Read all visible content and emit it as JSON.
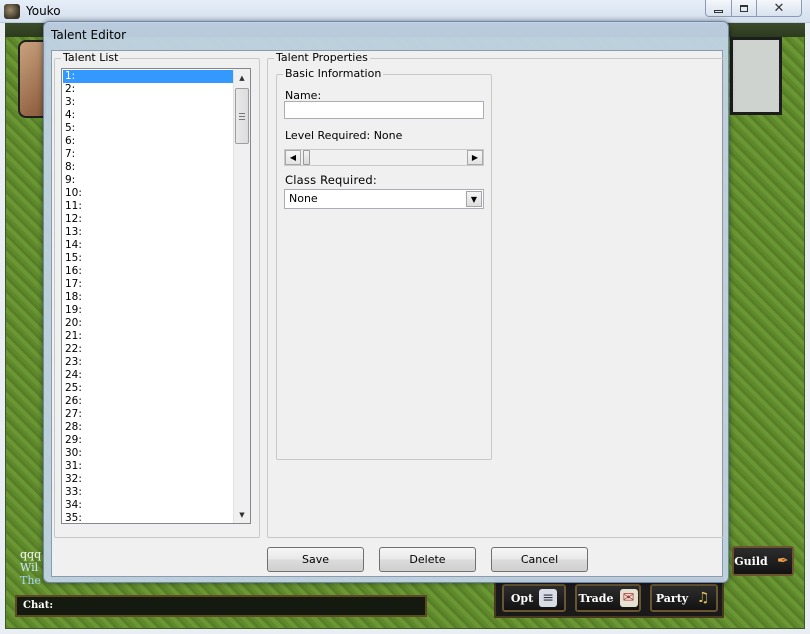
{
  "host": {
    "title": "Youko",
    "close_glyph": "✕"
  },
  "game": {
    "chat_lines": [
      "qqq",
      "Wil",
      "The"
    ],
    "chat_label": "Chat:",
    "buttons": {
      "guild": "Guild",
      "opt": "Opt",
      "trade": "Trade",
      "party": "Party"
    },
    "icons": {
      "guild": "feather-icon",
      "opt": "document-icon",
      "trade": "envelope-icon",
      "party": "harp-icon"
    }
  },
  "dialog": {
    "title": "Talent Editor",
    "talent_list": {
      "label": "Talent List",
      "items": [
        "1:",
        "2:",
        "3:",
        "4:",
        "5:",
        "6:",
        "7:",
        "8:",
        "9:",
        "10:",
        "11:",
        "12:",
        "13:",
        "14:",
        "15:",
        "16:",
        "17:",
        "18:",
        "19:",
        "20:",
        "21:",
        "22:",
        "23:",
        "24:",
        "25:",
        "26:",
        "27:",
        "28:",
        "29:",
        "30:",
        "31:",
        "32:",
        "33:",
        "34:",
        "35:"
      ],
      "selected_index": 0
    },
    "properties": {
      "label": "Talent Properties",
      "basic": {
        "label": "Basic Information",
        "name_label": "Name:",
        "name_value": "",
        "level_label": "Level Required: None",
        "class_label": "Class Required:",
        "class_value": "None"
      }
    },
    "buttons": {
      "save": "Save",
      "delete": "Delete",
      "cancel": "Cancel"
    }
  }
}
